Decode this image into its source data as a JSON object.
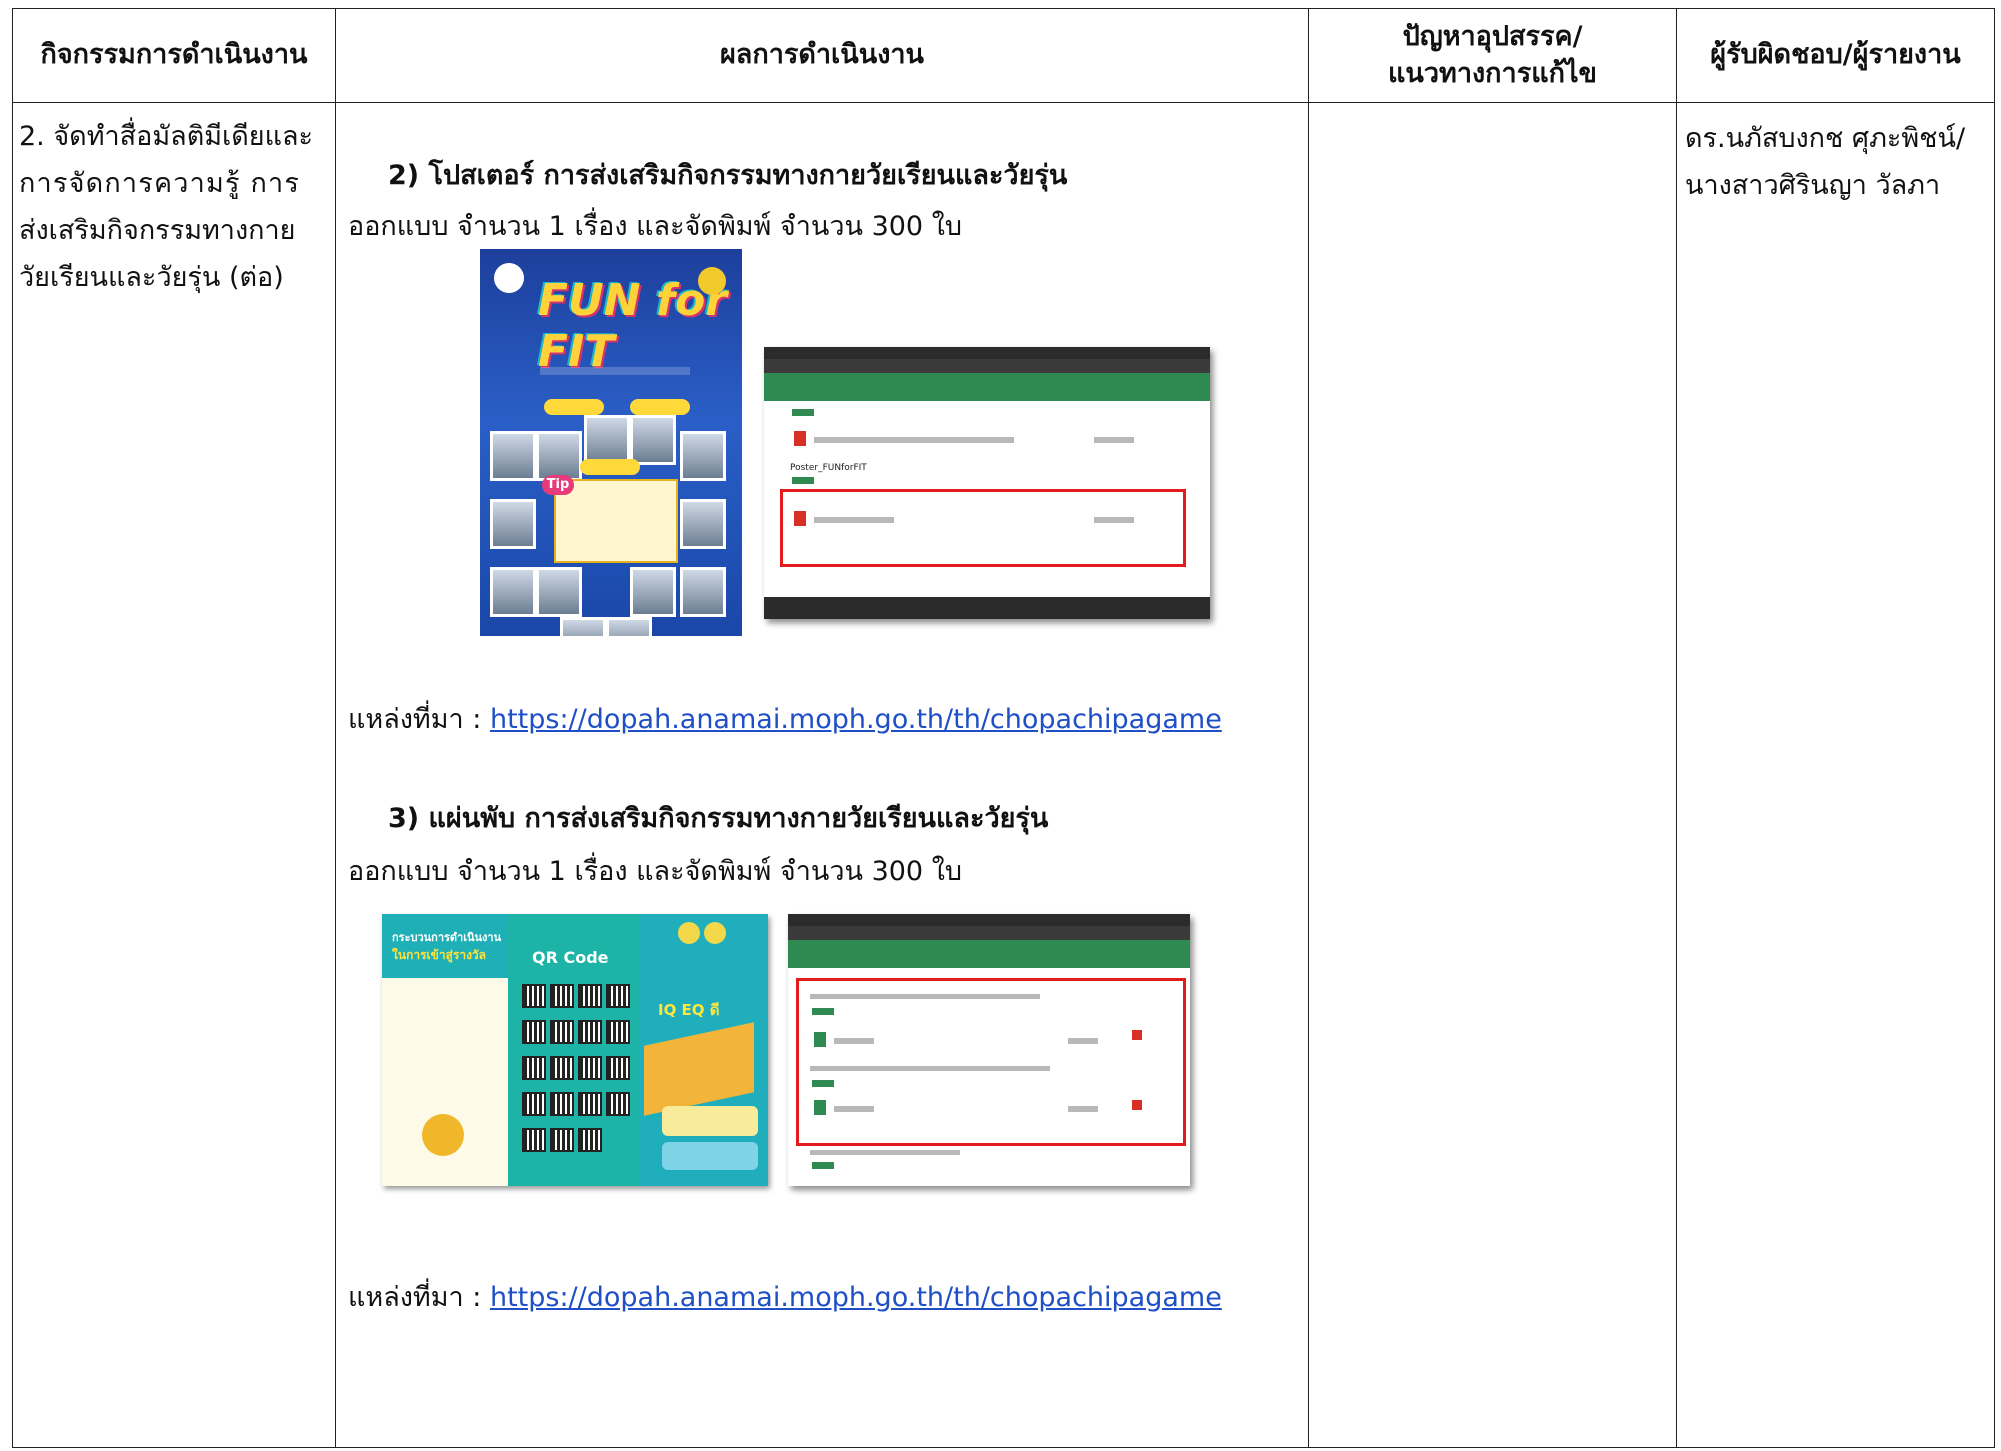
{
  "table": {
    "headers": {
      "activity": "กิจกรรมการดำเนินงาน",
      "result": "ผลการดำเนินงาน",
      "problem_line1": "ปัญหาอุปสรรค/",
      "problem_line2": "แนวทางการแก้ไข",
      "owner": "ผู้รับผิดชอบ/ผู้รายงาน"
    },
    "activity_lines": [
      "2. จัดทำสื่อมัลติมีเดียและ",
      "การจัดการความรู้ การ",
      "ส่งเสริมกิจกรรมทางกาย",
      "วัยเรียนและวัยรุ่น (ต่อ)"
    ],
    "owner_lines": [
      "ดร.นภัสบงกช ศุภะพิชน์/",
      "นางสาวศิรินญา วัลภา"
    ],
    "items": [
      {
        "heading": "2) โปสเตอร์ การส่งเสริมกิจกรรมทางกายวัยเรียนและวัยรุ่น",
        "detail": "ออกแบบ จำนวน 1 เรื่อง และจัดพิมพ์ จำนวน 300 ใบ",
        "source_label": "แหล่งที่มา : ",
        "source_url": "https://dopah.anamai.moph.go.th/th/chopachipagame"
      },
      {
        "heading": "3) แผ่นพับ การส่งเสริมกิจกรรมทางกายวัยเรียนและวัยรุ่น",
        "detail": "ออกแบบ จำนวน 1 เรื่อง และจัดพิมพ์ จำนวน 300 ใบ",
        "source_label": "แหล่งที่มา : ",
        "source_url": "https://dopah.anamai.moph.go.th/th/chopachipagame"
      }
    ],
    "poster_image": {
      "title": "FUN for FIT",
      "tip_label": "Tip"
    },
    "browser_shot_1": {
      "file_group": "Poster_FUNforFIT"
    },
    "leaflet_image": {
      "left_title_line1": "กระบวนการดำเนินงาน",
      "left_title_line2": "ในการเข้าสู่รางวัล",
      "qr_title": "QR Code",
      "iq_eq": "IQ EQ ดี"
    },
    "colors": {
      "link": "#1f4fc7",
      "browser_nav": "#2f8a52",
      "highlight_box": "#e21b1b",
      "poster_bg": "#2a5fc7",
      "leaflet_teal": "#1fb0b7"
    }
  }
}
